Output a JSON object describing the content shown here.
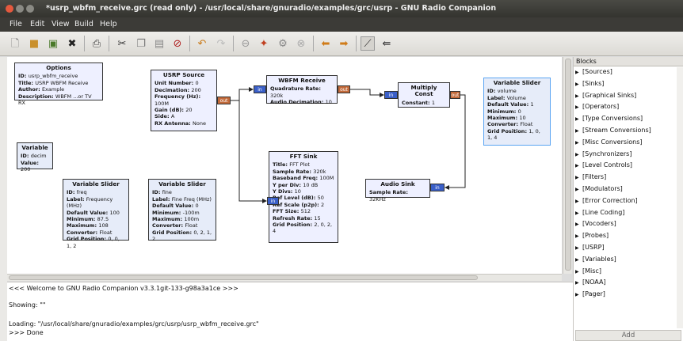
{
  "window": {
    "title": "*usrp_wbfm_receive.grc (read only) - /usr/local/share/gnuradio/examples/grc/usrp - GNU Radio Companion",
    "controls": {
      "close": "#e5593e",
      "minimize": "#8a8a84",
      "maximize": "#8a8a84"
    }
  },
  "menu": [
    "File",
    "Edit",
    "View",
    "Build",
    "Help"
  ],
  "toolbar": {
    "icons": [
      "new-file-icon",
      "open-folder-icon",
      "save-icon",
      "close-x-icon",
      "print-icon",
      "cut-icon",
      "copy-icon",
      "paste-icon",
      "delete-icon",
      "undo-icon",
      "redo-icon",
      "disable-icon",
      "generate-icon",
      "execute-icon",
      "kill-icon",
      "rotate-left-icon",
      "rotate-right-icon",
      "find-blocks-icon",
      "reload-icon"
    ]
  },
  "blocks": {
    "options": {
      "title": "Options",
      "props": [
        [
          "ID",
          "usrp_wbfm_receive"
        ],
        [
          "Title",
          "USRP WBFM Receive"
        ],
        [
          "Author",
          "Example"
        ],
        [
          "Description",
          "WBFM ...or TV RX"
        ]
      ]
    },
    "variable_decim": {
      "title": "Variable",
      "props": [
        [
          "ID",
          "decim"
        ],
        [
          "Value",
          "200"
        ]
      ]
    },
    "slider_freq": {
      "title": "Variable Slider",
      "props": [
        [
          "ID",
          "freq"
        ],
        [
          "Label",
          "Frequency (MHz)"
        ],
        [
          "Default Value",
          "100"
        ],
        [
          "Minimum",
          "87.5"
        ],
        [
          "Maximum",
          "108"
        ],
        [
          "Converter",
          "Float"
        ],
        [
          "Grid Position",
          "0, 0, 1, 2"
        ]
      ]
    },
    "slider_fine": {
      "title": "Variable Slider",
      "props": [
        [
          "ID",
          "fine"
        ],
        [
          "Label",
          "Fine Freq (MHz)"
        ],
        [
          "Default Value",
          "0"
        ],
        [
          "Minimum",
          "-100m"
        ],
        [
          "Maximum",
          "100m"
        ],
        [
          "Converter",
          "Float"
        ],
        [
          "Grid Position",
          "0, 2, 1, 2"
        ]
      ]
    },
    "usrp_source": {
      "title": "USRP Source",
      "props": [
        [
          "Unit Number",
          "0"
        ],
        [
          "Decimation",
          "200"
        ],
        [
          "Frequency (Hz)",
          "100M"
        ],
        [
          "Gain (dB)",
          "20"
        ],
        [
          "Side",
          "A"
        ],
        [
          "RX Antenna",
          "None"
        ]
      ],
      "port_out": "out"
    },
    "wbfm_receive": {
      "title": "WBFM Receive",
      "props": [
        [
          "Quadrature Rate",
          "320k"
        ],
        [
          "Audio Decimation",
          "10"
        ]
      ],
      "port_in": "in",
      "port_out": "out"
    },
    "fft_sink": {
      "title": "FFT Sink",
      "props": [
        [
          "Title",
          "FFT Plot"
        ],
        [
          "Sample Rate",
          "320k"
        ],
        [
          "Baseband Freq",
          "100M"
        ],
        [
          "Y per Div",
          "10 dB"
        ],
        [
          "Y Divs",
          "10"
        ],
        [
          "Ref Level (dB)",
          "50"
        ],
        [
          "Ref Scale (p2p)",
          "2"
        ],
        [
          "FFT Size",
          "512"
        ],
        [
          "Refresh Rate",
          "15"
        ],
        [
          "Grid Position",
          "2, 0, 2, 4"
        ]
      ],
      "port_in": "in"
    },
    "multiply_const": {
      "title": "Multiply Const",
      "props": [
        [
          "Constant",
          "1"
        ]
      ],
      "port_in": "in",
      "port_out": "out"
    },
    "slider_volume": {
      "title": "Variable Slider",
      "props": [
        [
          "ID",
          "volume"
        ],
        [
          "Label",
          "Volume"
        ],
        [
          "Default Value",
          "1"
        ],
        [
          "Minimum",
          "0"
        ],
        [
          "Maximum",
          "10"
        ],
        [
          "Converter",
          "Float"
        ],
        [
          "Grid Position",
          "1, 0, 1, 4"
        ]
      ]
    },
    "audio_sink": {
      "title": "Audio Sink",
      "props": [
        [
          "Sample Rate",
          "32KHz"
        ]
      ],
      "port_in": "in"
    }
  },
  "panel": {
    "header": "Blocks",
    "categories": [
      "[Sources]",
      "[Sinks]",
      "[Graphical Sinks]",
      "[Operators]",
      "[Type Conversions]",
      "[Stream Conversions]",
      "[Misc Conversions]",
      "[Synchronizers]",
      "[Level Controls]",
      "[Filters]",
      "[Modulators]",
      "[Error Correction]",
      "[Line Coding]",
      "[Vocoders]",
      "[Probes]",
      "[USRP]",
      "[Variables]",
      "[Misc]",
      "[NOAA]",
      "[Pager]"
    ],
    "expand_glyph": "▶",
    "add_label": "Add"
  },
  "console": {
    "lines": [
      "<<< Welcome to GNU Radio Companion v3.3.1git-133-g98a3a1ce >>>",
      "",
      "Showing: \"\"",
      "",
      "Loading: \"/usr/local/share/gnuradio/examples/grc/usrp/usrp_wbfm_receive.grc\"",
      ">>> Done"
    ]
  }
}
